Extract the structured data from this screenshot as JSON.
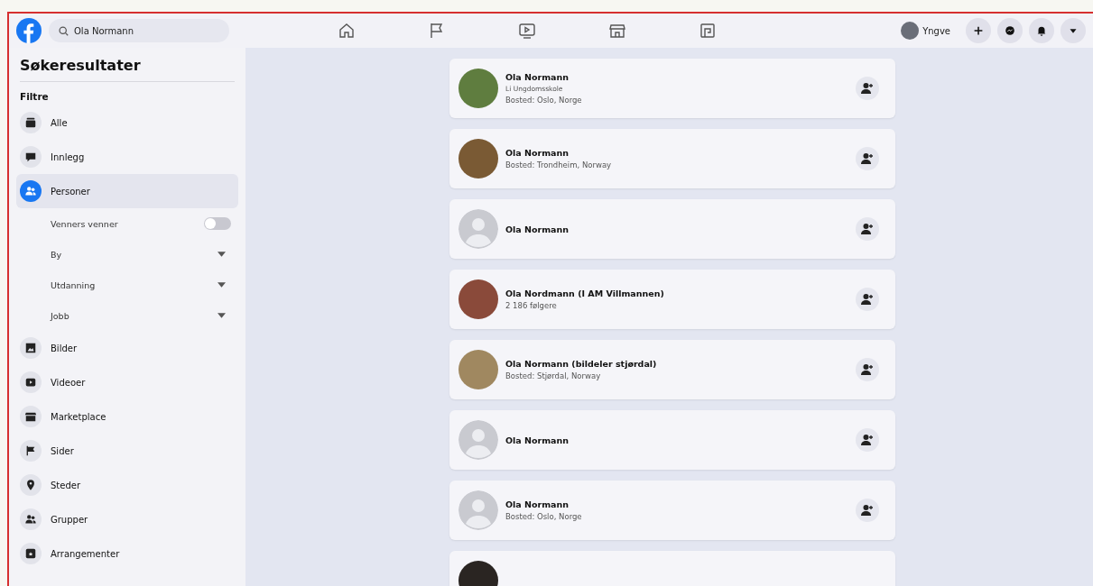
{
  "top_bar": {
    "search": {
      "value": "Ola Normann"
    },
    "nav": [
      {
        "selected": false
      },
      {
        "selected": false
      },
      {
        "selected": false
      },
      {
        "selected": false
      },
      {
        "selected": false
      }
    ],
    "profile": {
      "name": "Yngve"
    }
  },
  "sidebar": {
    "title": "Søkeresultater",
    "filters_heading": "Filtre",
    "filters": [
      {
        "label": "Alle",
        "selected": false
      },
      {
        "label": "Innlegg",
        "selected": false
      },
      {
        "label": "Personer",
        "selected": true,
        "subfilters": [
          {
            "kind": "toggle",
            "label": "Venners venner",
            "on": false
          },
          {
            "kind": "dropdown",
            "label": "By"
          },
          {
            "kind": "dropdown",
            "label": "Utdanning"
          },
          {
            "kind": "dropdown",
            "label": "Jobb"
          }
        ]
      },
      {
        "label": "Bilder",
        "selected": false
      },
      {
        "label": "Videoer",
        "selected": false
      },
      {
        "label": "Marketplace",
        "selected": false
      },
      {
        "label": "Sider",
        "selected": false
      },
      {
        "label": "Steder",
        "selected": false
      },
      {
        "label": "Grupper",
        "selected": false
      },
      {
        "label": "Arrangementer",
        "selected": false
      }
    ]
  },
  "results": [
    {
      "has_photo": true,
      "name": "Ola Normann",
      "lines": [
        "Li Ungdomsskole",
        "Bosted: Oslo, Norge"
      ]
    },
    {
      "has_photo": true,
      "name": "Ola Normann",
      "lines": [
        "Bosted: Trondheim, Norway"
      ]
    },
    {
      "has_photo": false,
      "name": "Ola Normann"
    },
    {
      "has_photo": true,
      "name": "Ola Nordmann (I AM Villmannen)",
      "lines": [
        "2 186 følgere"
      ]
    },
    {
      "has_photo": true,
      "name": "Ola Normann (bildeler stjørdal)",
      "lines": [
        "Bosted: Stjørdal, Norway"
      ]
    },
    {
      "has_photo": false,
      "name": "Ola Normann"
    },
    {
      "has_photo": false,
      "name": "Ola Normann",
      "lines": [
        "Bosted: Oslo, Norge"
      ]
    },
    {
      "has_photo": true
    }
  ]
}
